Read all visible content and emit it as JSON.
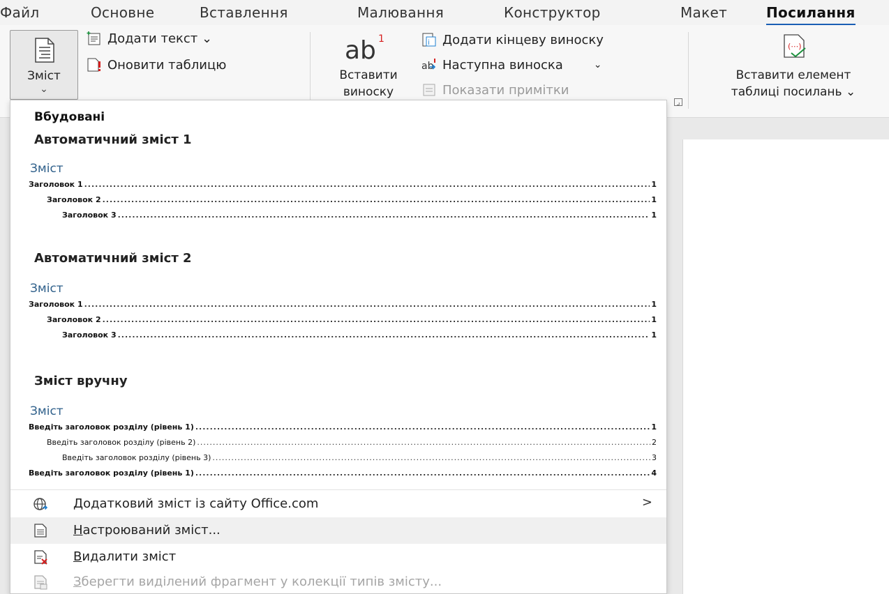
{
  "menu": {
    "tabs": [
      "Файл",
      "Основне",
      "Вставлення",
      "Малювання",
      "Конструктор",
      "Макет",
      "Посилання"
    ]
  },
  "ribbon": {
    "toc_button": "Зміст",
    "add_text": "Додати текст ⌄",
    "update_table": "Оновити таблицю",
    "insert_footnote_line1": "Вставити",
    "insert_footnote_line2": "виноску",
    "add_endnote": "Додати кінцеву виноску",
    "next_footnote": "Наступна виноска",
    "show_notes": "Показати примітки",
    "insert_toa_line1": "Вставити елемент",
    "insert_toa_line2": "таблиці посилань ⌄"
  },
  "dropdown": {
    "header": "Вбудовані",
    "auto1": {
      "title": "Автоматичний зміст 1",
      "preview_title": "Зміст",
      "entries": [
        {
          "text": "Заголовок 1",
          "page": "1"
        },
        {
          "text": "Заголовок 2",
          "page": "1"
        },
        {
          "text": "Заголовок 3",
          "page": "1"
        }
      ]
    },
    "auto2": {
      "title": "Автоматичний зміст 2",
      "preview_title": "Зміст",
      "entries": [
        {
          "text": "Заголовок 1",
          "page": "1"
        },
        {
          "text": "Заголовок 2",
          "page": "1"
        },
        {
          "text": "Заголовок 3",
          "page": "1"
        }
      ]
    },
    "manual": {
      "title": "Зміст вручну",
      "preview_title": "Зміст",
      "entries": [
        {
          "text": "Введіть заголовок розділу (рівень 1)",
          "page": "1"
        },
        {
          "text": "Введіть заголовок розділу (рівень 2)",
          "page": "2"
        },
        {
          "text": "Введіть заголовок розділу (рівень 3)",
          "page": "3"
        },
        {
          "text": "Введіть заголовок розділу (рівень 1)",
          "page": "4"
        }
      ]
    },
    "commands": {
      "more_from_office": "Додатковий зміст із сайту Office.com",
      "custom_key": "Н",
      "custom_rest": "астроюваний зміст...",
      "remove_key": "В",
      "remove_rest": "идалити зміст",
      "save_key": "З",
      "save_rest": "берегти виділений фрагмент у колекції типів змісту..."
    }
  },
  "colors": {
    "accent": "#1a5fb4",
    "preview_title": "#2e5f8a",
    "disabled": "#a5a5a5"
  }
}
